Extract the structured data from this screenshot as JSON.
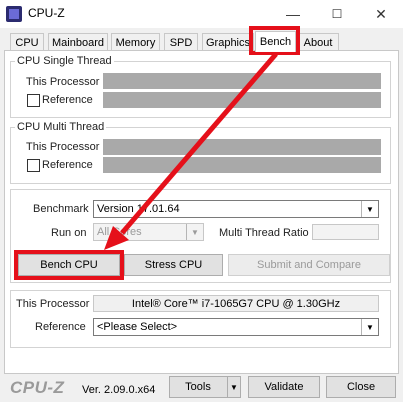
{
  "window": {
    "title": "CPU-Z",
    "minimize_glyph": "—",
    "maximize_glyph": "☐",
    "close_glyph": "✕"
  },
  "tabs": [
    {
      "label": "CPU",
      "active": false
    },
    {
      "label": "Mainboard",
      "active": false
    },
    {
      "label": "Memory",
      "active": false
    },
    {
      "label": "SPD",
      "active": false
    },
    {
      "label": "Graphics",
      "active": false
    },
    {
      "label": "Bench",
      "active": true
    },
    {
      "label": "About",
      "active": false
    }
  ],
  "single_thread": {
    "title": "CPU Single Thread",
    "this_processor_label": "This Processor",
    "reference_label": "Reference"
  },
  "multi_thread": {
    "title": "CPU Multi Thread",
    "this_processor_label": "This Processor",
    "reference_label": "Reference"
  },
  "controls": {
    "benchmark_label": "Benchmark",
    "benchmark_value": "Version 17.01.64",
    "run_on_label": "Run on",
    "run_on_value": "All Cores",
    "multi_thread_ratio_label": "Multi Thread Ratio",
    "bench_cpu_button": "Bench CPU",
    "stress_cpu_button": "Stress CPU",
    "submit_button": "Submit and Compare"
  },
  "processor": {
    "this_processor_label": "This Processor",
    "this_processor_value": "Intel® Core™ i7-1065G7 CPU @ 1.30GHz",
    "reference_label": "Reference",
    "reference_value": "<Please Select>"
  },
  "footer": {
    "logo": "CPU-Z",
    "version": "Ver. 2.09.0.x64",
    "tools_button": "Tools",
    "validate_button": "Validate",
    "close_button": "Close"
  },
  "icons": {
    "dropdown": "chevron-down-icon",
    "app": "cpu-z-app-icon"
  },
  "highlight_color": "#e5101a"
}
